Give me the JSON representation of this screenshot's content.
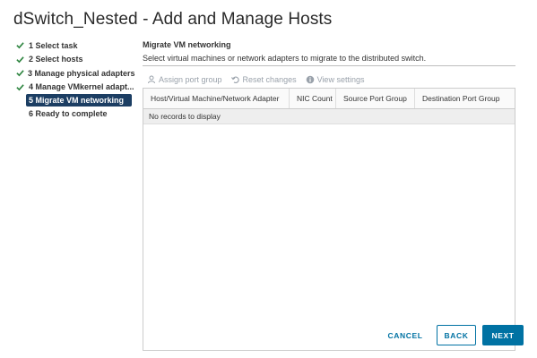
{
  "dialog": {
    "title": "dSwitch_Nested - Add and Manage Hosts"
  },
  "steps": [
    {
      "label": "1 Select task",
      "completed": true
    },
    {
      "label": "2 Select hosts",
      "completed": true
    },
    {
      "label": "3 Manage physical adapters",
      "completed": true
    },
    {
      "label": "4 Manage VMkernel adapt...",
      "completed": true
    },
    {
      "label": "5 Migrate VM networking",
      "completed": false,
      "active": true
    },
    {
      "label": "6 Ready to complete",
      "completed": false
    }
  ],
  "main": {
    "title": "Migrate VM networking",
    "subtitle": "Select virtual machines or network adapters to migrate to the distributed switch.",
    "toolbar": {
      "assign_label": "Assign port group",
      "reset_label": "Reset changes",
      "view_label": "View settings"
    },
    "grid": {
      "columns": [
        "Host/Virtual Machine/Network Adapter",
        "NIC Count",
        "Source Port Group",
        "Destination Port Group"
      ],
      "empty_text": "No records to display"
    }
  },
  "footer": {
    "cancel_label": "CANCEL",
    "back_label": "BACK",
    "next_label": "NEXT"
  },
  "colors": {
    "accent": "#0072a3",
    "active_step_bg": "#1c3e63",
    "check_green": "#2e8540",
    "disabled_text": "#9aa2ab"
  },
  "icons": {
    "check": "checkmark-icon",
    "assign": "assign-port-group-icon",
    "reset": "reset-changes-icon",
    "view": "info-icon"
  }
}
